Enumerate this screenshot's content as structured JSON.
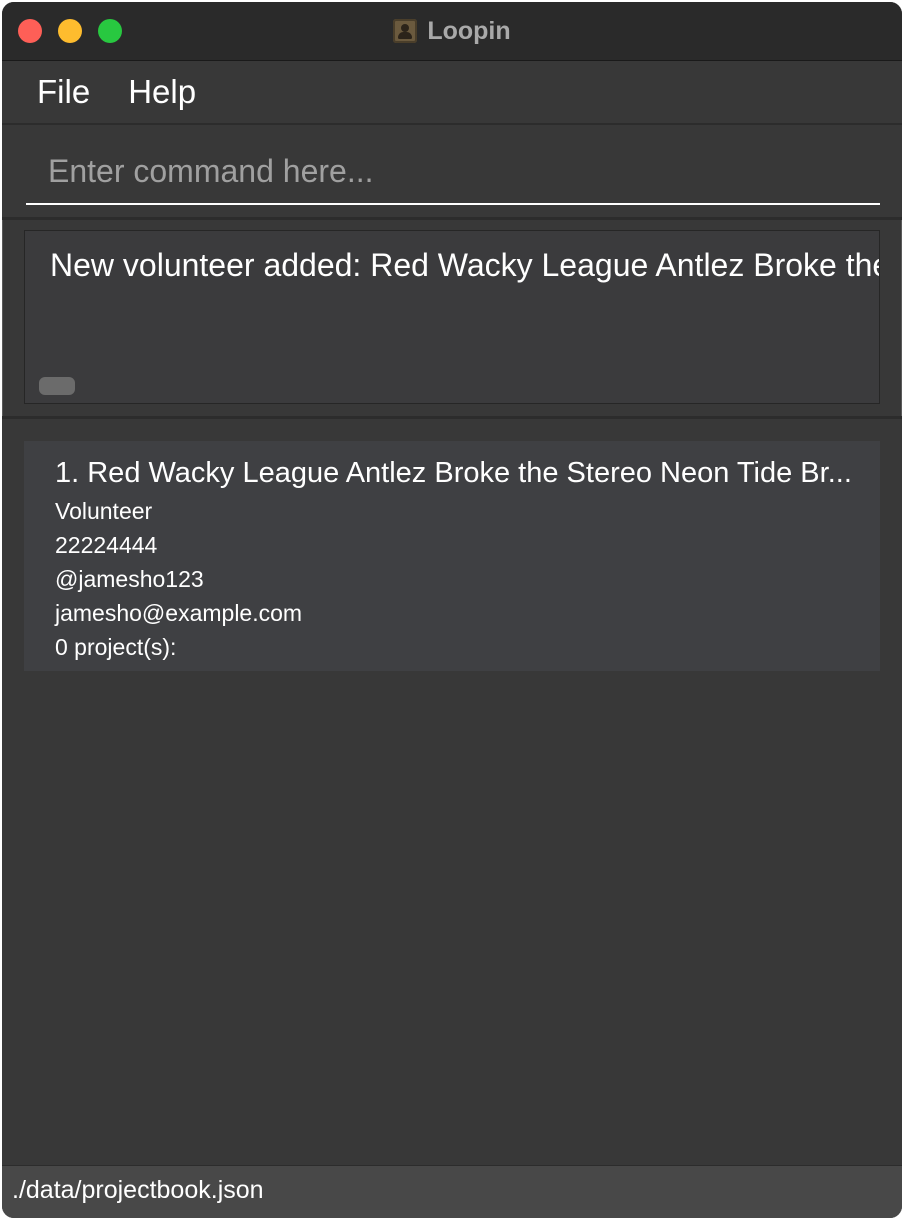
{
  "window": {
    "title": "Loopin",
    "app_icon": "contact-book-icon"
  },
  "menu": {
    "items": [
      {
        "label": "File"
      },
      {
        "label": "Help"
      }
    ]
  },
  "command": {
    "value": "",
    "placeholder": "Enter command here..."
  },
  "result": {
    "message": "New volunteer added: Red Wacky League Antlez Broke the Stereo Neon Tide Br..."
  },
  "people": [
    {
      "name": "1. Red Wacky League Antlez Broke the Stereo Neon Tide Br...",
      "role": "Volunteer",
      "phone": "22224444",
      "telegram": "@jamesho123",
      "email": "jamesho@example.com",
      "projects": "0 project(s):"
    }
  ],
  "status": {
    "file_path": "./data/projectbook.json"
  },
  "colors": {
    "window_bg": "#383838",
    "titlebar_bg": "#2a2a2a",
    "card_bg": "#3f4043",
    "status_bg": "#484848",
    "close": "#fe5f57",
    "minimize": "#febc2e",
    "maximize": "#28c840"
  }
}
